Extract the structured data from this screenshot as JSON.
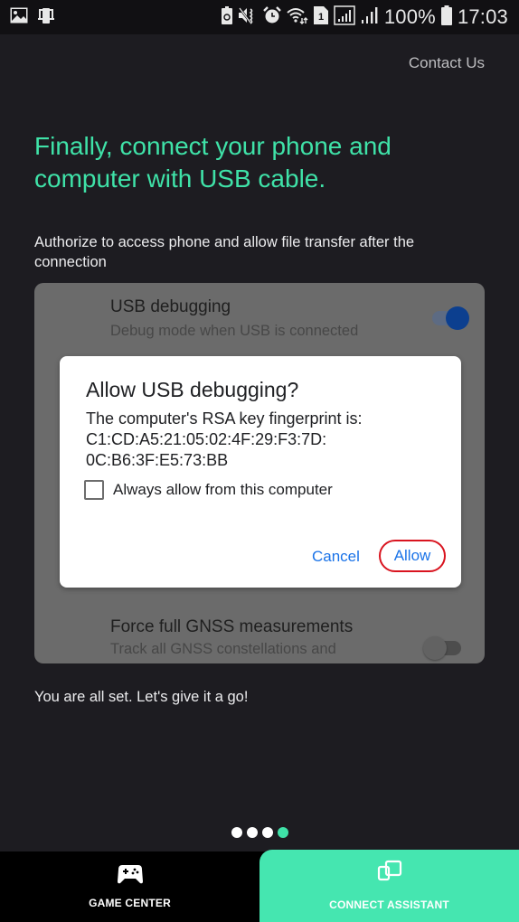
{
  "status_bar": {
    "left_icons": [
      "gallery-icon",
      "screen-mirror-icon"
    ],
    "right_icons": [
      "battery-saver-icon",
      "vibrate-mute-icon",
      "alarm-icon",
      "wifi-icon",
      "sim-1-icon",
      "signal-icon",
      "signal-icon-2"
    ],
    "sim_label": "1",
    "battery": "100%",
    "time": "17:03"
  },
  "header": {
    "contact_link": "Contact Us"
  },
  "main": {
    "headline": "Finally, connect your phone and computer with USB cable.",
    "subtext": "Authorize to access phone and allow file transfer after the connection",
    "illustration": {
      "settings": [
        {
          "title": "USB debugging",
          "subtitle": "Debug mode when USB is connected",
          "enabled": true
        },
        {
          "title": "Force full GNSS measurements",
          "subtitle": "Track all GNSS constellations and",
          "enabled": false
        }
      ],
      "dialog": {
        "title": "Allow USB debugging?",
        "body_line1": "The computer's RSA key fingerprint is:",
        "body_line2": "C1:CD:A5:21:05:02:4F:29:F3:7D:",
        "body_line3": "0C:B6:3F:E5:73:BB",
        "checkbox_label": "Always allow from this computer",
        "checkbox_checked": false,
        "cancel_label": "Cancel",
        "allow_label": "Allow"
      }
    },
    "footer_text": "You are all set. Let's give it a go!"
  },
  "pager": {
    "total": 4,
    "current": 4
  },
  "bottom_nav": {
    "tabs": [
      {
        "label": "GAME CENTER",
        "icon": "gamepad-icon",
        "active": false
      },
      {
        "label": "CONNECT ASSISTANT",
        "icon": "connect-screens-icon",
        "active": true
      }
    ]
  },
  "colors": {
    "accent": "#3fe2a8",
    "active_tab_bg": "#45e6b0",
    "background": "#1d1c21",
    "dialog_button": "#1a73e8",
    "highlight_ring": "#d9141f"
  }
}
